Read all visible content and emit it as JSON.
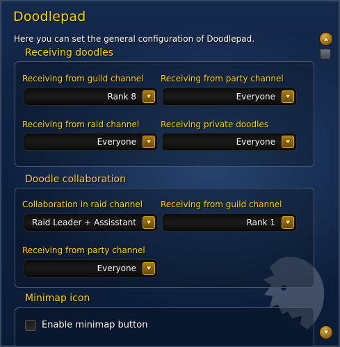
{
  "window": {
    "title": "Doodlepad",
    "description": "Here you can set the general configuration of Doodlepad."
  },
  "sections": [
    {
      "title": "Receiving doodles",
      "fields": [
        {
          "label": "Receiving from guild channel",
          "value": "Rank 8"
        },
        {
          "label": "Receiving from party channel",
          "value": "Everyone"
        },
        {
          "label": "Receiving from raid channel",
          "value": "Everyone"
        },
        {
          "label": "Receiving private doodles",
          "value": "Everyone"
        }
      ]
    },
    {
      "title": "Doodle collaboration",
      "fields": [
        {
          "label": "Collaboration in raid channel",
          "value": "Raid Leader + Assisstant"
        },
        {
          "label": "Receiving from guild channel",
          "value": "Rank 1"
        },
        {
          "label": "Receiving from party channel",
          "value": "Everyone"
        }
      ]
    },
    {
      "title": "Minimap icon",
      "checkbox": {
        "label": "Enable minimap button",
        "checked": false
      }
    }
  ],
  "icons": {
    "dropdown_arrow": "chevron-down-icon",
    "scroll_up": "scroll-up-arrow-icon",
    "scroll_down": "scroll-down-arrow-icon",
    "watermark": "lion-head-icon"
  },
  "colors": {
    "accent_gold": "#ffd200",
    "background": "#0d2140",
    "text": "#ffffff"
  }
}
